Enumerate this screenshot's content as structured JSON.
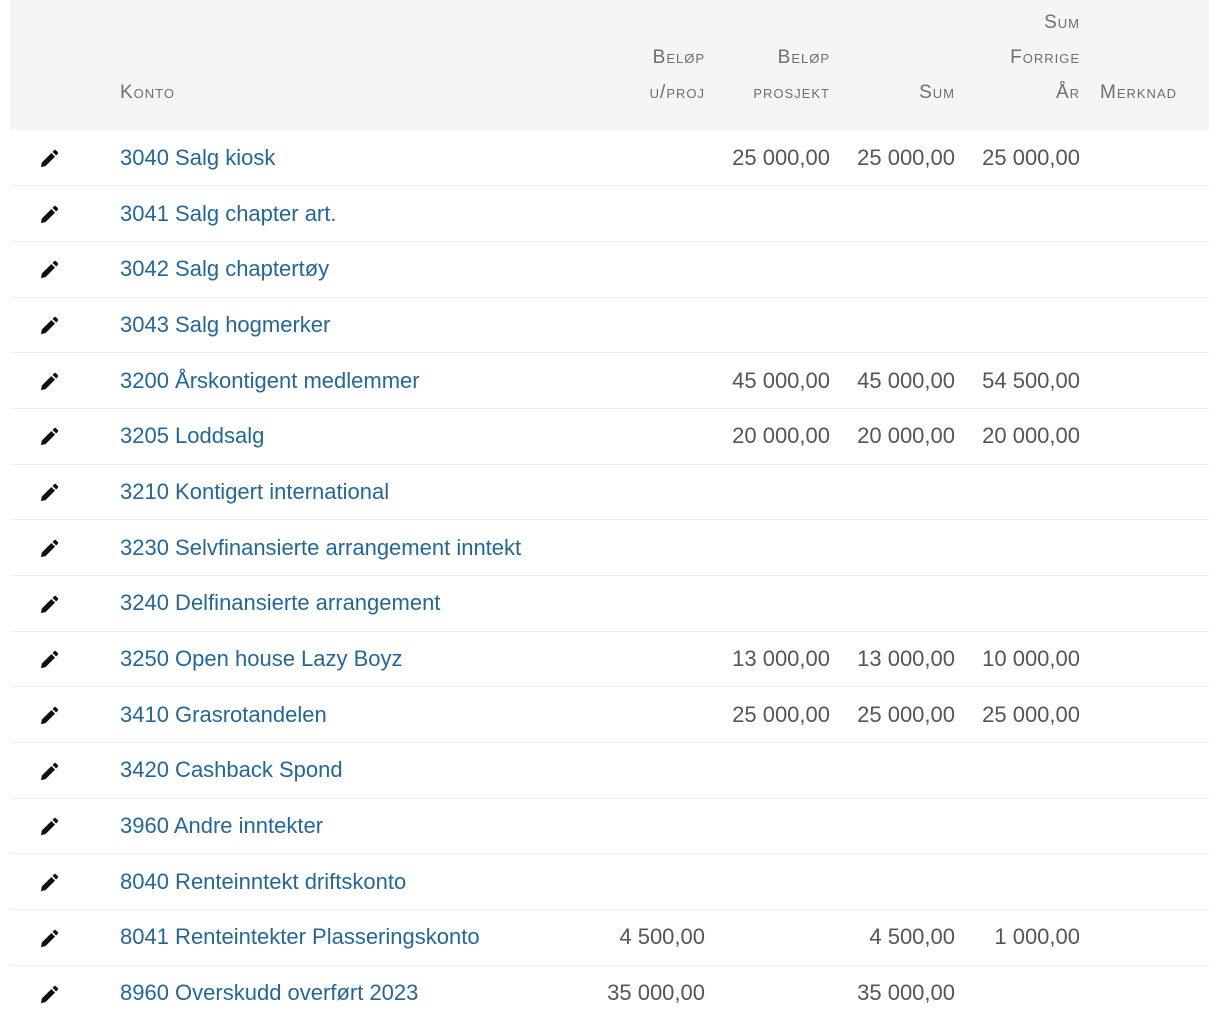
{
  "columns": {
    "konto": "Konto",
    "belop_uproj": [
      "Beløp",
      "u/proj"
    ],
    "belop_prosjekt": [
      "Beløp",
      "prosjekt"
    ],
    "sum": "Sum",
    "sum_forrige_ar": [
      "Sum",
      "Forrige",
      "År"
    ],
    "merknad": "Merknad"
  },
  "edit_icon": "pencil-icon",
  "colors": {
    "link": "#23679a",
    "header_bg": "#f5f5f5",
    "header_text": "#6e6e6e",
    "amount_text": "#555555"
  },
  "rows": [
    {
      "konto": "3040 Salg kiosk",
      "belop_uproj": "",
      "belop_prosjekt": "25 000,00",
      "sum": "25 000,00",
      "sum_forrige_ar": "25 000,00",
      "merknad": ""
    },
    {
      "konto": "3041 Salg chapter art.",
      "belop_uproj": "",
      "belop_prosjekt": "",
      "sum": "",
      "sum_forrige_ar": "",
      "merknad": ""
    },
    {
      "konto": "3042 Salg chaptertøy",
      "belop_uproj": "",
      "belop_prosjekt": "",
      "sum": "",
      "sum_forrige_ar": "",
      "merknad": ""
    },
    {
      "konto": "3043 Salg hogmerker",
      "belop_uproj": "",
      "belop_prosjekt": "",
      "sum": "",
      "sum_forrige_ar": "",
      "merknad": ""
    },
    {
      "konto": "3200 Årskontigent medlemmer",
      "belop_uproj": "",
      "belop_prosjekt": "45 000,00",
      "sum": "45 000,00",
      "sum_forrige_ar": "54 500,00",
      "merknad": ""
    },
    {
      "konto": "3205 Loddsalg",
      "belop_uproj": "",
      "belop_prosjekt": "20 000,00",
      "sum": "20 000,00",
      "sum_forrige_ar": "20 000,00",
      "merknad": ""
    },
    {
      "konto": "3210 Kontigert international",
      "belop_uproj": "",
      "belop_prosjekt": "",
      "sum": "",
      "sum_forrige_ar": "",
      "merknad": ""
    },
    {
      "konto": "3230 Selvfinansierte arrangement inntekt",
      "belop_uproj": "",
      "belop_prosjekt": "",
      "sum": "",
      "sum_forrige_ar": "",
      "merknad": ""
    },
    {
      "konto": "3240 Delfinansierte arrangement",
      "belop_uproj": "",
      "belop_prosjekt": "",
      "sum": "",
      "sum_forrige_ar": "",
      "merknad": ""
    },
    {
      "konto": "3250 Open house Lazy Boyz",
      "belop_uproj": "",
      "belop_prosjekt": "13 000,00",
      "sum": "13 000,00",
      "sum_forrige_ar": "10 000,00",
      "merknad": ""
    },
    {
      "konto": "3410 Grasrotandelen",
      "belop_uproj": "",
      "belop_prosjekt": "25 000,00",
      "sum": "25 000,00",
      "sum_forrige_ar": "25 000,00",
      "merknad": ""
    },
    {
      "konto": "3420 Cashback Spond",
      "belop_uproj": "",
      "belop_prosjekt": "",
      "sum": "",
      "sum_forrige_ar": "",
      "merknad": ""
    },
    {
      "konto": "3960 Andre inntekter",
      "belop_uproj": "",
      "belop_prosjekt": "",
      "sum": "",
      "sum_forrige_ar": "",
      "merknad": ""
    },
    {
      "konto": "8040 Renteinntekt driftskonto",
      "belop_uproj": "",
      "belop_prosjekt": "",
      "sum": "",
      "sum_forrige_ar": "",
      "merknad": ""
    },
    {
      "konto": "8041 Renteintekter Plasseringskonto",
      "belop_uproj": "4 500,00",
      "belop_prosjekt": "",
      "sum": "4 500,00",
      "sum_forrige_ar": "1 000,00",
      "merknad": ""
    },
    {
      "konto": "8960 Overskudd overført 2023",
      "belop_uproj": "35 000,00",
      "belop_prosjekt": "",
      "sum": "35 000,00",
      "sum_forrige_ar": "",
      "merknad": ""
    }
  ]
}
